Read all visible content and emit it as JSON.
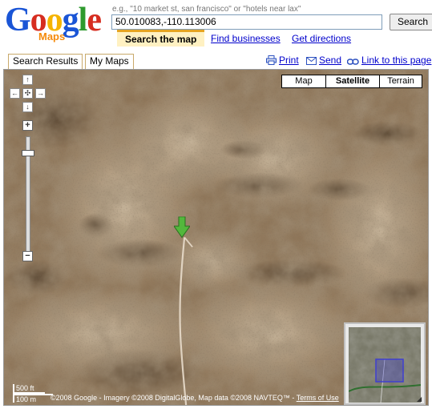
{
  "logo": {
    "word": "Google",
    "sub": "Maps"
  },
  "search": {
    "hint": "e.g., \"10 market st, san francisco\" or \"hotels near lax\"",
    "value": "50.010083,-110.113006",
    "button_label": "Search"
  },
  "tabs": {
    "search_map": "Search the map",
    "find_businesses": "Find businesses",
    "get_directions": "Get directions"
  },
  "panel_tabs": {
    "search_results": "Search Results",
    "my_maps": "My Maps"
  },
  "tools": {
    "print": "Print",
    "send": "Send",
    "link": "Link to this page"
  },
  "map_types": {
    "map": "Map",
    "satellite": "Satellite",
    "terrain": "Terrain",
    "selected": "Satellite"
  },
  "pan_arrows": {
    "up": "↑",
    "down": "↓",
    "left": "←",
    "right": "→",
    "center": "✣"
  },
  "zoom": {
    "in": "+",
    "out": "−",
    "level_fraction": 0.12
  },
  "scale": {
    "feet": "500 ft",
    "meters": "100 m"
  },
  "copyright": {
    "text": "©2008 Google - Imagery ©2008 DigitalGlobe, Map data ©2008 NAVTEQ™ - ",
    "terms": "Terms of Use"
  },
  "colors": {
    "accent_tab": "#fff1c2",
    "link": "#0000cc",
    "marker": "#53b73c",
    "overview_box": "#3f3fcf"
  },
  "icons": {
    "print": "printer-icon",
    "send": "envelope-icon",
    "link": "chain-link-icon",
    "marker": "green-arrow-marker-icon"
  }
}
